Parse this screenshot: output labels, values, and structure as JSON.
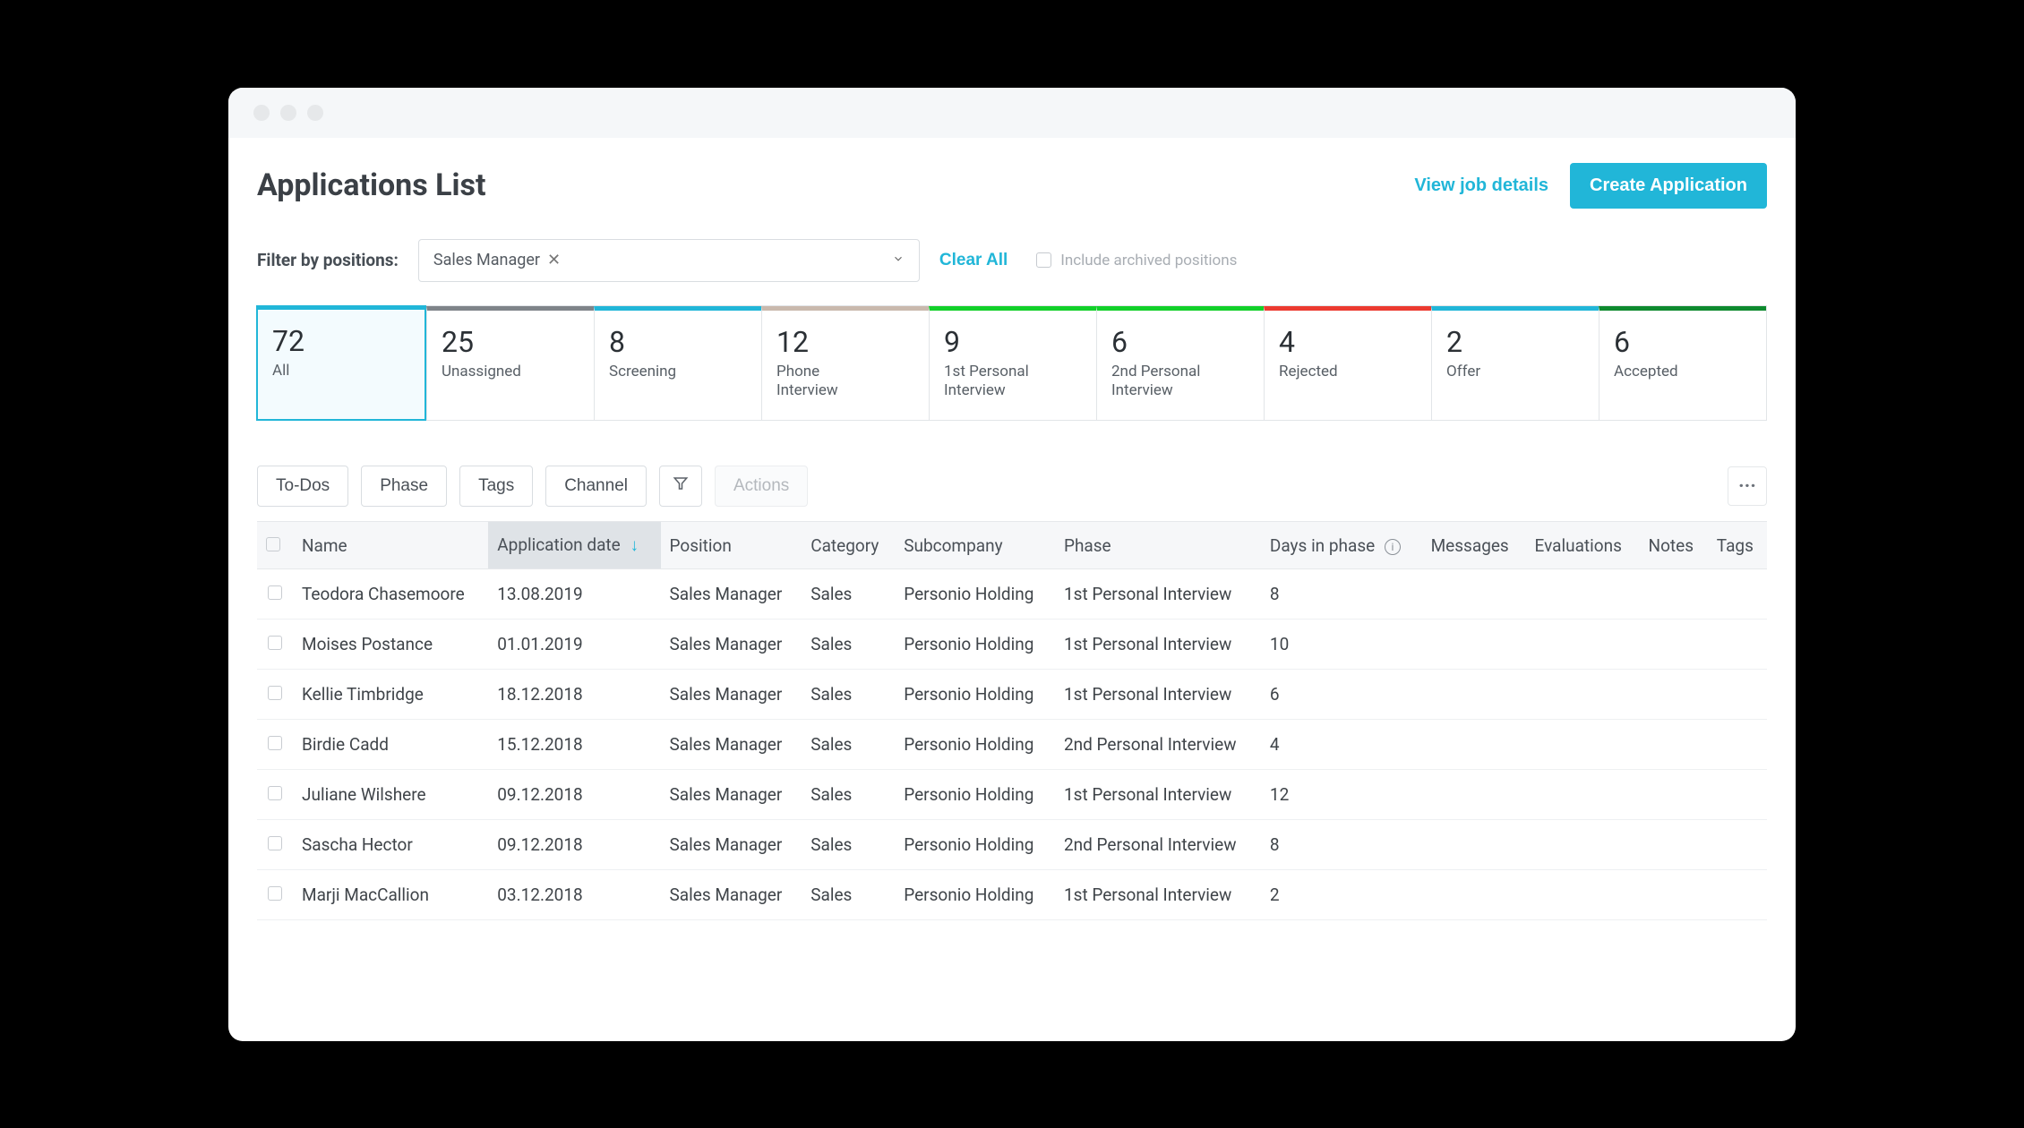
{
  "header": {
    "title": "Applications List",
    "view_job_details": "View job details",
    "create_application": "Create Application"
  },
  "filter": {
    "label": "Filter by positions:",
    "chip_label": "Sales Manager",
    "clear_all": "Clear All",
    "archived_label": "Include archived positions"
  },
  "stages": [
    {
      "count": "72",
      "label": "All",
      "color": "#21b6d8",
      "selected": true
    },
    {
      "count": "25",
      "label": "Unassigned",
      "color": "#7f8489",
      "selected": false
    },
    {
      "count": "8",
      "label": "Screening",
      "color": "#21b6d8",
      "selected": false
    },
    {
      "count": "12",
      "label": "Phone\nInterview",
      "color": "#c9b9ad",
      "selected": false
    },
    {
      "count": "9",
      "label": "1st Personal\nInterview",
      "color": "#12d029",
      "selected": false
    },
    {
      "count": "6",
      "label": "2nd Personal\nInterview",
      "color": "#12d029",
      "selected": false
    },
    {
      "count": "4",
      "label": "Rejected",
      "color": "#ec3a30",
      "selected": false
    },
    {
      "count": "2",
      "label": "Offer",
      "color": "#21b6d8",
      "selected": false
    },
    {
      "count": "6",
      "label": "Accepted",
      "color": "#0e8a2e",
      "selected": false
    }
  ],
  "toolbar": {
    "todos": "To-Dos",
    "phase": "Phase",
    "tags": "Tags",
    "channel": "Channel",
    "actions": "Actions"
  },
  "columns": {
    "name": "Name",
    "application_date": "Application date",
    "position": "Position",
    "category": "Category",
    "subcompany": "Subcompany",
    "phase": "Phase",
    "days_in_phase": "Days in phase",
    "messages": "Messages",
    "evaluations": "Evaluations",
    "notes": "Notes",
    "tags": "Tags"
  },
  "rows": [
    {
      "name": "Teodora Chasemoore",
      "date": "13.08.2019",
      "position": "Sales Manager",
      "category": "Sales",
      "subcompany": "Personio Holding",
      "phase": "1st Personal Interview",
      "days": "8"
    },
    {
      "name": "Moises Postance",
      "date": "01.01.2019",
      "position": "Sales Manager",
      "category": "Sales",
      "subcompany": "Personio Holding",
      "phase": "1st Personal Interview",
      "days": "10"
    },
    {
      "name": "Kellie Timbridge",
      "date": "18.12.2018",
      "position": "Sales Manager",
      "category": "Sales",
      "subcompany": "Personio Holding",
      "phase": "1st Personal Interview",
      "days": "6"
    },
    {
      "name": "Birdie Cadd",
      "date": "15.12.2018",
      "position": "Sales Manager",
      "category": "Sales",
      "subcompany": "Personio Holding",
      "phase": "2nd Personal Interview",
      "days": "4"
    },
    {
      "name": "Juliane Wilshere",
      "date": "09.12.2018",
      "position": "Sales Manager",
      "category": "Sales",
      "subcompany": "Personio Holding",
      "phase": "1st Personal Interview",
      "days": "12"
    },
    {
      "name": "Sascha Hector",
      "date": "09.12.2018",
      "position": "Sales Manager",
      "category": "Sales",
      "subcompany": "Personio Holding",
      "phase": "2nd Personal Interview",
      "days": "8"
    },
    {
      "name": "Marji MacCallion",
      "date": "03.12.2018",
      "position": "Sales Manager",
      "category": "Sales",
      "subcompany": "Personio Holding",
      "phase": "1st Personal Interview",
      "days": "2"
    }
  ]
}
